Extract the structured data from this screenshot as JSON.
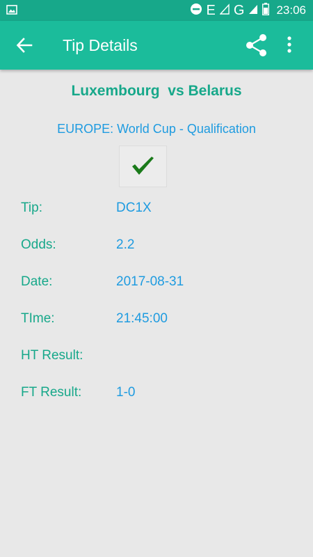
{
  "status_bar": {
    "network_label": "E",
    "network2_label": "G",
    "time": "23:06"
  },
  "app_bar": {
    "title": "Tip Details"
  },
  "match": {
    "title": "Luxembourg  vs Belarus",
    "competition": "EUROPE: World Cup - Qualification",
    "result_icon": "checkmark-icon"
  },
  "details": [
    {
      "label": "Tip:",
      "value": "DC1X"
    },
    {
      "label": "Odds:",
      "value": "2.2"
    },
    {
      "label": "Date:",
      "value": "2017-08-31"
    },
    {
      "label": "TIme:",
      "value": "21:45:00"
    },
    {
      "label": "HT Result:",
      "value": ""
    },
    {
      "label": "FT Result:",
      "value": "1-0"
    }
  ],
  "colors": {
    "status_bar": "#17a88a",
    "app_bar": "#1bbc9b",
    "label": "#17a88a",
    "value": "#1e9be0",
    "background": "#e8e8e8",
    "check": "#1a7a1a"
  }
}
